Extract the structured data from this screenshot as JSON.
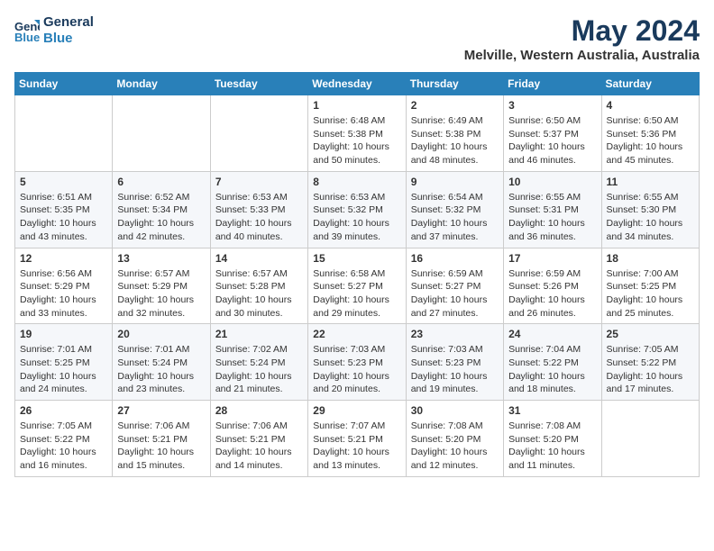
{
  "header": {
    "logo_line1": "General",
    "logo_line2": "Blue",
    "title": "May 2024",
    "subtitle": "Melville, Western Australia, Australia"
  },
  "columns": [
    "Sunday",
    "Monday",
    "Tuesday",
    "Wednesday",
    "Thursday",
    "Friday",
    "Saturday"
  ],
  "weeks": [
    [
      {
        "day": "",
        "info": ""
      },
      {
        "day": "",
        "info": ""
      },
      {
        "day": "",
        "info": ""
      },
      {
        "day": "1",
        "info": "Sunrise: 6:48 AM\nSunset: 5:38 PM\nDaylight: 10 hours\nand 50 minutes."
      },
      {
        "day": "2",
        "info": "Sunrise: 6:49 AM\nSunset: 5:38 PM\nDaylight: 10 hours\nand 48 minutes."
      },
      {
        "day": "3",
        "info": "Sunrise: 6:50 AM\nSunset: 5:37 PM\nDaylight: 10 hours\nand 46 minutes."
      },
      {
        "day": "4",
        "info": "Sunrise: 6:50 AM\nSunset: 5:36 PM\nDaylight: 10 hours\nand 45 minutes."
      }
    ],
    [
      {
        "day": "5",
        "info": "Sunrise: 6:51 AM\nSunset: 5:35 PM\nDaylight: 10 hours\nand 43 minutes."
      },
      {
        "day": "6",
        "info": "Sunrise: 6:52 AM\nSunset: 5:34 PM\nDaylight: 10 hours\nand 42 minutes."
      },
      {
        "day": "7",
        "info": "Sunrise: 6:53 AM\nSunset: 5:33 PM\nDaylight: 10 hours\nand 40 minutes."
      },
      {
        "day": "8",
        "info": "Sunrise: 6:53 AM\nSunset: 5:32 PM\nDaylight: 10 hours\nand 39 minutes."
      },
      {
        "day": "9",
        "info": "Sunrise: 6:54 AM\nSunset: 5:32 PM\nDaylight: 10 hours\nand 37 minutes."
      },
      {
        "day": "10",
        "info": "Sunrise: 6:55 AM\nSunset: 5:31 PM\nDaylight: 10 hours\nand 36 minutes."
      },
      {
        "day": "11",
        "info": "Sunrise: 6:55 AM\nSunset: 5:30 PM\nDaylight: 10 hours\nand 34 minutes."
      }
    ],
    [
      {
        "day": "12",
        "info": "Sunrise: 6:56 AM\nSunset: 5:29 PM\nDaylight: 10 hours\nand 33 minutes."
      },
      {
        "day": "13",
        "info": "Sunrise: 6:57 AM\nSunset: 5:29 PM\nDaylight: 10 hours\nand 32 minutes."
      },
      {
        "day": "14",
        "info": "Sunrise: 6:57 AM\nSunset: 5:28 PM\nDaylight: 10 hours\nand 30 minutes."
      },
      {
        "day": "15",
        "info": "Sunrise: 6:58 AM\nSunset: 5:27 PM\nDaylight: 10 hours\nand 29 minutes."
      },
      {
        "day": "16",
        "info": "Sunrise: 6:59 AM\nSunset: 5:27 PM\nDaylight: 10 hours\nand 27 minutes."
      },
      {
        "day": "17",
        "info": "Sunrise: 6:59 AM\nSunset: 5:26 PM\nDaylight: 10 hours\nand 26 minutes."
      },
      {
        "day": "18",
        "info": "Sunrise: 7:00 AM\nSunset: 5:25 PM\nDaylight: 10 hours\nand 25 minutes."
      }
    ],
    [
      {
        "day": "19",
        "info": "Sunrise: 7:01 AM\nSunset: 5:25 PM\nDaylight: 10 hours\nand 24 minutes."
      },
      {
        "day": "20",
        "info": "Sunrise: 7:01 AM\nSunset: 5:24 PM\nDaylight: 10 hours\nand 23 minutes."
      },
      {
        "day": "21",
        "info": "Sunrise: 7:02 AM\nSunset: 5:24 PM\nDaylight: 10 hours\nand 21 minutes."
      },
      {
        "day": "22",
        "info": "Sunrise: 7:03 AM\nSunset: 5:23 PM\nDaylight: 10 hours\nand 20 minutes."
      },
      {
        "day": "23",
        "info": "Sunrise: 7:03 AM\nSunset: 5:23 PM\nDaylight: 10 hours\nand 19 minutes."
      },
      {
        "day": "24",
        "info": "Sunrise: 7:04 AM\nSunset: 5:22 PM\nDaylight: 10 hours\nand 18 minutes."
      },
      {
        "day": "25",
        "info": "Sunrise: 7:05 AM\nSunset: 5:22 PM\nDaylight: 10 hours\nand 17 minutes."
      }
    ],
    [
      {
        "day": "26",
        "info": "Sunrise: 7:05 AM\nSunset: 5:22 PM\nDaylight: 10 hours\nand 16 minutes."
      },
      {
        "day": "27",
        "info": "Sunrise: 7:06 AM\nSunset: 5:21 PM\nDaylight: 10 hours\nand 15 minutes."
      },
      {
        "day": "28",
        "info": "Sunrise: 7:06 AM\nSunset: 5:21 PM\nDaylight: 10 hours\nand 14 minutes."
      },
      {
        "day": "29",
        "info": "Sunrise: 7:07 AM\nSunset: 5:21 PM\nDaylight: 10 hours\nand 13 minutes."
      },
      {
        "day": "30",
        "info": "Sunrise: 7:08 AM\nSunset: 5:20 PM\nDaylight: 10 hours\nand 12 minutes."
      },
      {
        "day": "31",
        "info": "Sunrise: 7:08 AM\nSunset: 5:20 PM\nDaylight: 10 hours\nand 11 minutes."
      },
      {
        "day": "",
        "info": ""
      }
    ]
  ]
}
